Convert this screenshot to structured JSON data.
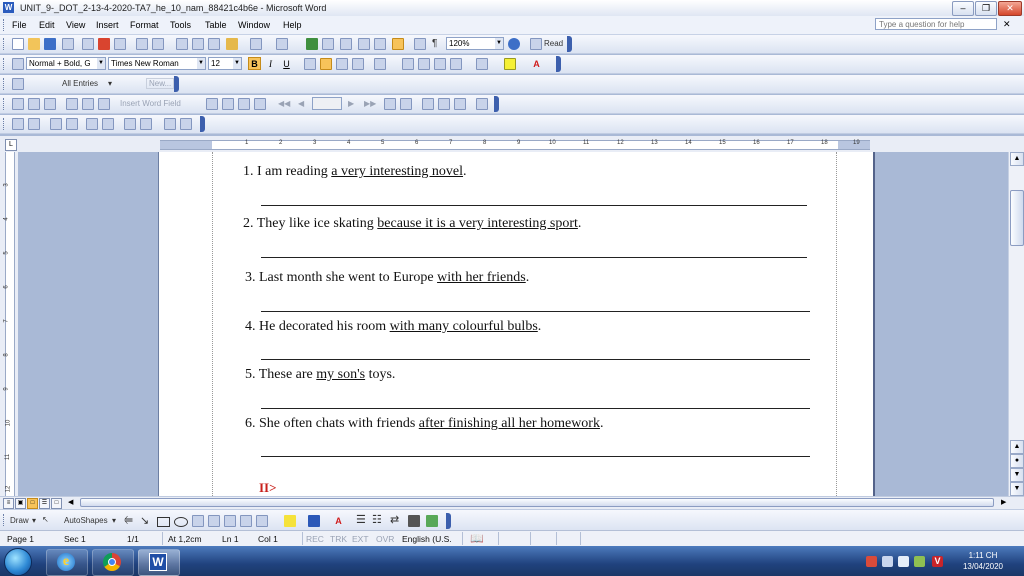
{
  "window": {
    "title": "UNIT_9-_DOT_2-13-4-2020-TA7_he_10_nam_88421c4b6e - Microsoft Word",
    "app_icon": "word-icon"
  },
  "menu": {
    "items": [
      "File",
      "Edit",
      "View",
      "Insert",
      "Format",
      "Tools",
      "Table",
      "Window",
      "Help"
    ],
    "ask_placeholder": "Type a question for help"
  },
  "toolbar": {
    "zoom": "120%",
    "read_label": "Read",
    "style": "Normal + Bold, G",
    "font": "Times New Roman",
    "font_size": "12",
    "bold": "B",
    "italic": "I",
    "underline": "U",
    "font_color_label": "A"
  },
  "autotext": {
    "entries_label": "All Entries",
    "new_label": "New..."
  },
  "mailmerge": {
    "insert_word_field": "Insert Word Field"
  },
  "ruler": {
    "tab_selector": "L",
    "h_numbers": [
      "1",
      "2",
      "3",
      "4",
      "5",
      "6",
      "7",
      "8",
      "9",
      "10",
      "11",
      "12",
      "13",
      "14",
      "15",
      "16",
      "17",
      "18",
      "19"
    ],
    "v_numbers": [
      "3",
      "4",
      "5",
      "6",
      "7",
      "8",
      "9",
      "10",
      "11",
      "12"
    ]
  },
  "document": {
    "questions": [
      {
        "num": "1.",
        "pre": "I am reading ",
        "underlined": "a very interesting novel",
        "post": "."
      },
      {
        "num": "2.",
        "pre": "They like ice skating ",
        "underlined": "because it is a very interesting sport",
        "post": "."
      },
      {
        "num": "3.",
        "pre": "Last month she went to Europe ",
        "underlined": "with her friends",
        "post": "."
      },
      {
        "num": "4.",
        "pre": "He decorated his room ",
        "underlined": "with many colourful bulbs",
        "post": "."
      },
      {
        "num": "5.",
        "pre": "These are ",
        "underlined": "my son's",
        "post": " toys."
      },
      {
        "num": "6.",
        "pre": "She often chats with friends ",
        "underlined": "after finishing all her homework",
        "post": "."
      }
    ],
    "section_heading": "II>"
  },
  "drawing": {
    "draw_label": "Draw",
    "autoshapes_label": "AutoShapes",
    "font_color_label": "A"
  },
  "status": {
    "page": "Page 1",
    "sec": "Sec 1",
    "pages": "1/1",
    "at": "At 1,2cm",
    "ln": "Ln 1",
    "col": "Col 1",
    "rec": "REC",
    "trk": "TRK",
    "ext": "EXT",
    "ovr": "OVR",
    "language": "English (U.S."
  },
  "taskbar": {
    "time": "1:11 CH",
    "date": "13/04/2020",
    "apps": [
      "internet-explorer-icon",
      "chrome-icon",
      "word-icon"
    ]
  },
  "colors": {
    "accent": "#2a5bbd",
    "toolbar_active": "#f7c35a",
    "section_red": "#c8211c",
    "workspace": "#a9b9d6"
  }
}
